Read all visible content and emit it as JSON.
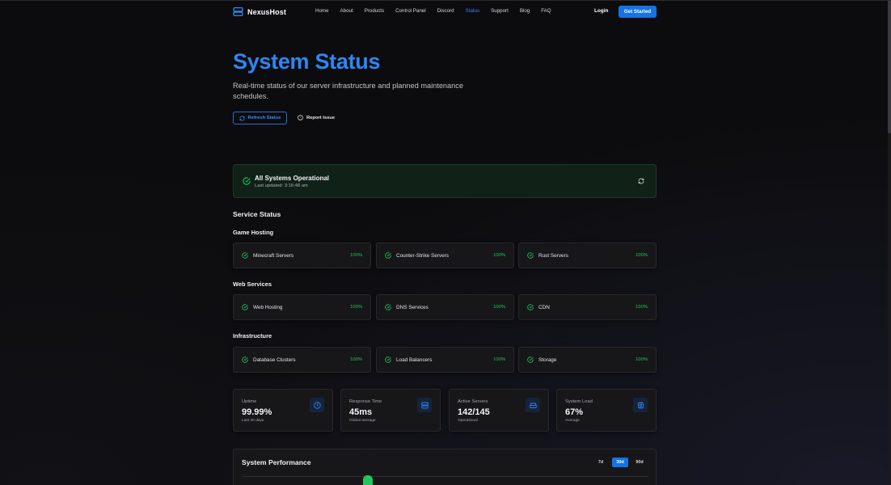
{
  "nav": {
    "brand": "NexusHost",
    "links": [
      "Home",
      "About",
      "Products",
      "Control Panel",
      "Discord",
      "Status",
      "Support",
      "Blog",
      "FAQ"
    ],
    "active_link": "Status",
    "login": "Login",
    "cta": "Get Started"
  },
  "hero": {
    "title": "System Status",
    "subtitle": "Real-time status of our server infrastructure and planned maintenance schedules.",
    "refresh_label": "Refresh Status",
    "report_label": "Report Issue"
  },
  "banner": {
    "title": "All Systems Operational",
    "last_updated": "Last updated: 3:16:48 am"
  },
  "service_status_title": "Service Status",
  "groups": [
    {
      "title": "Game Hosting",
      "services": [
        {
          "name": "Minecraft Servers",
          "uptime": "100%"
        },
        {
          "name": "Counter-Strike Servers",
          "uptime": "100%"
        },
        {
          "name": "Rust Servers",
          "uptime": "100%"
        }
      ]
    },
    {
      "title": "Web Services",
      "services": [
        {
          "name": "Web Hosting",
          "uptime": "100%"
        },
        {
          "name": "DNS Services",
          "uptime": "100%"
        },
        {
          "name": "CDN",
          "uptime": "100%"
        }
      ]
    },
    {
      "title": "Infrastructure",
      "services": [
        {
          "name": "Database Clusters",
          "uptime": "100%"
        },
        {
          "name": "Load Balancers",
          "uptime": "100%"
        },
        {
          "name": "Storage",
          "uptime": "100%"
        }
      ]
    }
  ],
  "metrics": [
    {
      "label": "Uptime",
      "value": "99.99%",
      "sub": "Last 30 days",
      "icon": "clock-icon"
    },
    {
      "label": "Response Time",
      "value": "45ms",
      "sub": "Global average",
      "icon": "server-icon"
    },
    {
      "label": "Active Servers",
      "value": "142/145",
      "sub": "Operational",
      "icon": "hard-drive-icon"
    },
    {
      "label": "System Load",
      "value": "67%",
      "sub": "Average",
      "icon": "cpu-icon"
    }
  ],
  "performance": {
    "title": "System Performance",
    "ranges": [
      "7d",
      "30d",
      "90d"
    ],
    "active_range": "30d"
  },
  "colors": {
    "accent": "#1573e6",
    "title_blue": "#2f86f3",
    "success": "#22c55e",
    "background": "#0c0c0e"
  }
}
